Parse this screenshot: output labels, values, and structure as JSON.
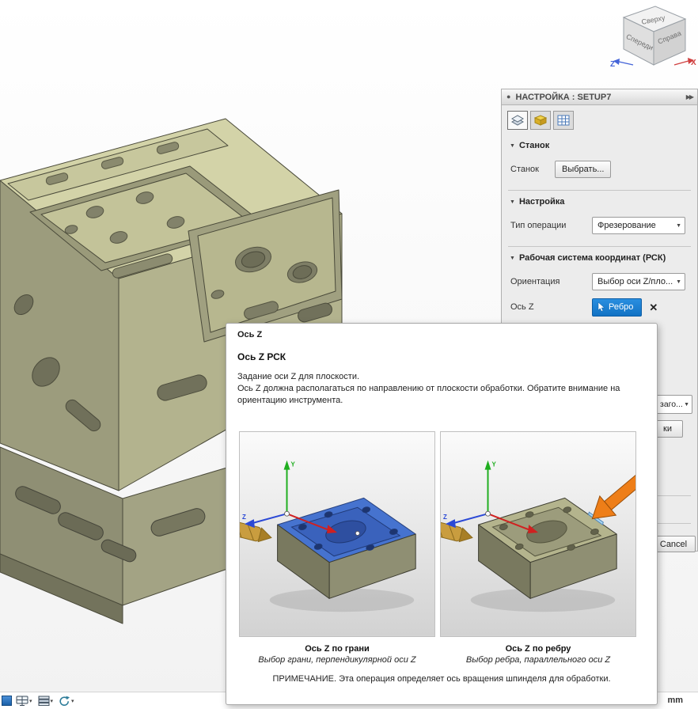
{
  "icons": {
    "collapse": "▶▶",
    "section_arrow": "▼",
    "dropdown_arrow": "▼",
    "close": "✕",
    "menu_caret": "▾",
    "dialog_bullet": "●"
  },
  "viewcube": {
    "top_label": "Сверху",
    "front_label": "Спереди",
    "right_label": "Справа",
    "axis_z": "Z",
    "axis_x": "X"
  },
  "panel": {
    "title": "НАСТРОЙКА : SETUP7",
    "machine_section_title": "Станок",
    "machine_label": "Станок",
    "machine_select_button": "Выбрать...",
    "setup_section_title": "Настройка",
    "operation_type_label": "Тип операции",
    "operation_type_value": "Фрезерование",
    "wcs_section_title": "Рабочая система координат (РСК)",
    "orientation_label": "Ориентация",
    "orientation_value": "Выбор оси Z/пло...",
    "z_axis_label": "Ось Z",
    "z_axis_button_label": "Ребро",
    "stock_dropdown_fragment": "заго...",
    "button_fragment": "ки",
    "cancel_button": "Cancel"
  },
  "tooltip": {
    "header": "Ось Z",
    "title": "Ось Z РСК",
    "line1": "Задание оси Z для плоскости.",
    "line2": "Ось Z должна располагаться по направлению от плоскости обработки. Обратите внимание на ориентацию инструмента.",
    "axis_y_label": "Y",
    "axis_z_label": "Z",
    "left_image_title": "Ось Z по грани",
    "left_image_subtitle": "Выбор грани, перпендикулярной оси Z",
    "right_image_title": "Ось Z по ребру",
    "right_image_subtitle": "Выбор ребра, параллельного оси Z",
    "note": "ПРИМЕЧАНИЕ. Эта операция определяет ось вращения шпинделя для обработки."
  },
  "statusbar": {
    "units": "mm"
  },
  "colors": {
    "accent_blue": "#1a7fd4",
    "highlight_face_blue": "#4673cf",
    "callout_orange": "#ee7e18",
    "part_khaki": "#d3d3a8"
  }
}
